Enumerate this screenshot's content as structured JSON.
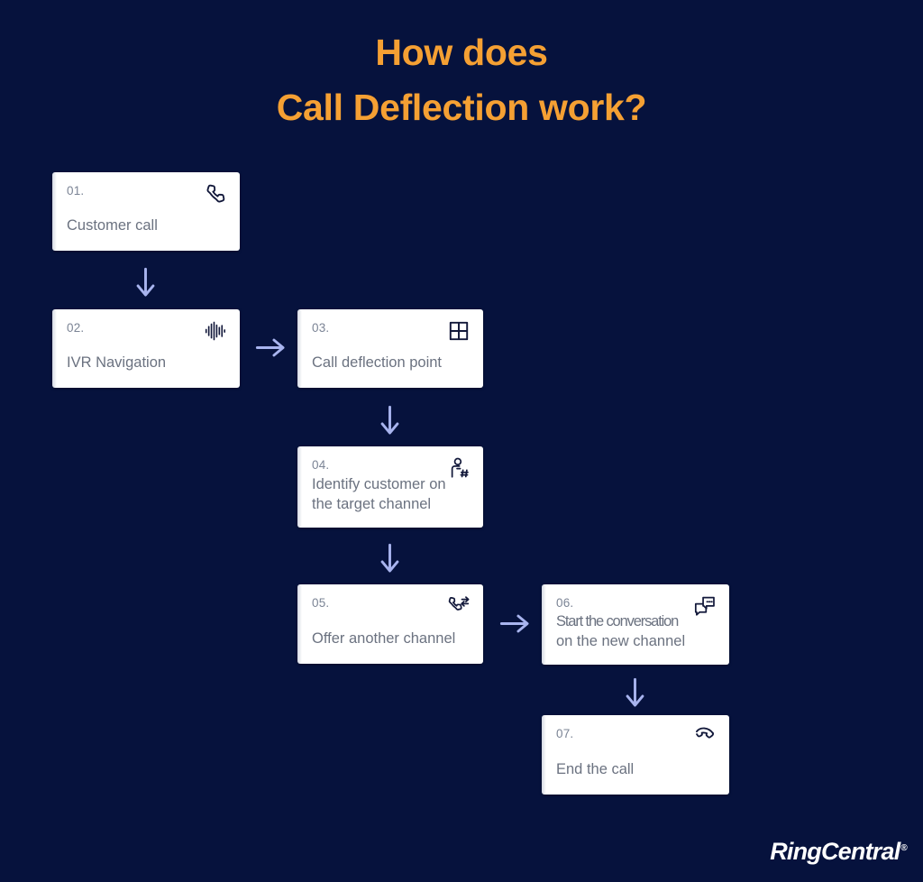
{
  "title": {
    "line1": "How does",
    "line2": "Call Deflection work?"
  },
  "colors": {
    "background": "#06123d",
    "title": "#f5a033",
    "card_background": "#ffffff",
    "card_number": "#7b8495",
    "card_label": "#6b7280",
    "card_icon": "#12183a",
    "arrow": "#a8b4ef",
    "logo": "#ffffff"
  },
  "steps": [
    {
      "number": "01.",
      "label": "Customer call",
      "label_line1": "Customer call",
      "label_line2": "",
      "icon": "phone-icon"
    },
    {
      "number": "02.",
      "label": "IVR Navigation",
      "label_line1": "IVR Navigation",
      "label_line2": "",
      "icon": "audio-waveform-icon"
    },
    {
      "number": "03.",
      "label": "Call deflection point",
      "label_line1": "Call deflection point",
      "label_line2": "",
      "icon": "grid-four-squares-icon"
    },
    {
      "number": "04.",
      "label": "Identify customer on the target channel",
      "label_line1": "Identify customer on",
      "label_line2": "the target channel",
      "icon": "person-hash-icon"
    },
    {
      "number": "05.",
      "label": "Offer another channel",
      "label_line1": "Offer another channel",
      "label_line2": "",
      "icon": "phone-transfer-icon"
    },
    {
      "number": "06.",
      "label": "Start the conversation on the new channel",
      "label_line1": "Start the conversation",
      "label_line2": "on the new channel",
      "icon": "chat-bubbles-icon"
    },
    {
      "number": "07.",
      "label": "End the call",
      "label_line1": "End the call",
      "label_line2": "",
      "icon": "phone-hangup-icon"
    }
  ],
  "connectors": [
    {
      "name": "arrow-step1-to-step2",
      "direction": "down"
    },
    {
      "name": "arrow-step2-to-step3",
      "direction": "right"
    },
    {
      "name": "arrow-step3-to-step4",
      "direction": "down"
    },
    {
      "name": "arrow-step4-to-step5",
      "direction": "down"
    },
    {
      "name": "arrow-step5-to-step6",
      "direction": "right"
    },
    {
      "name": "arrow-step6-to-step7",
      "direction": "down"
    }
  ],
  "logo": {
    "text": "RingCentral",
    "trademark": "®"
  }
}
